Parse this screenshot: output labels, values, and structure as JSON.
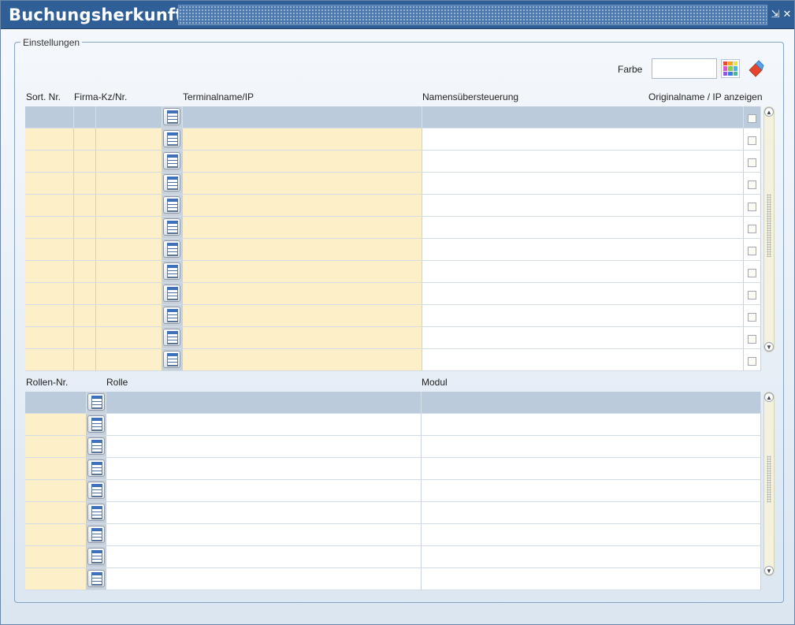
{
  "window": {
    "title": "Buchungsherkunft",
    "minimize_glyph": "⇲",
    "close_glyph": "✕"
  },
  "group": {
    "legend": "Einstellungen"
  },
  "farbe": {
    "label": "Farbe",
    "value": "",
    "palette_icon": "color-palette-icon",
    "eraser_icon": "eraser-icon"
  },
  "terminal_table": {
    "columns": [
      "Sort. Nr.",
      "Firma-Kz/Nr.",
      "Terminalname/IP",
      "Namensübersteuerung",
      "Originalname / IP anzeigen"
    ],
    "row_count": 11
  },
  "rollen_table": {
    "columns": [
      "Rollen-Nr.",
      "Rolle",
      "Modul"
    ],
    "row_count": 8
  },
  "colors": {
    "titlebar": "#2f5f96",
    "readonly_cell": "#fdefc8",
    "filter_row": "#bccbdc"
  }
}
